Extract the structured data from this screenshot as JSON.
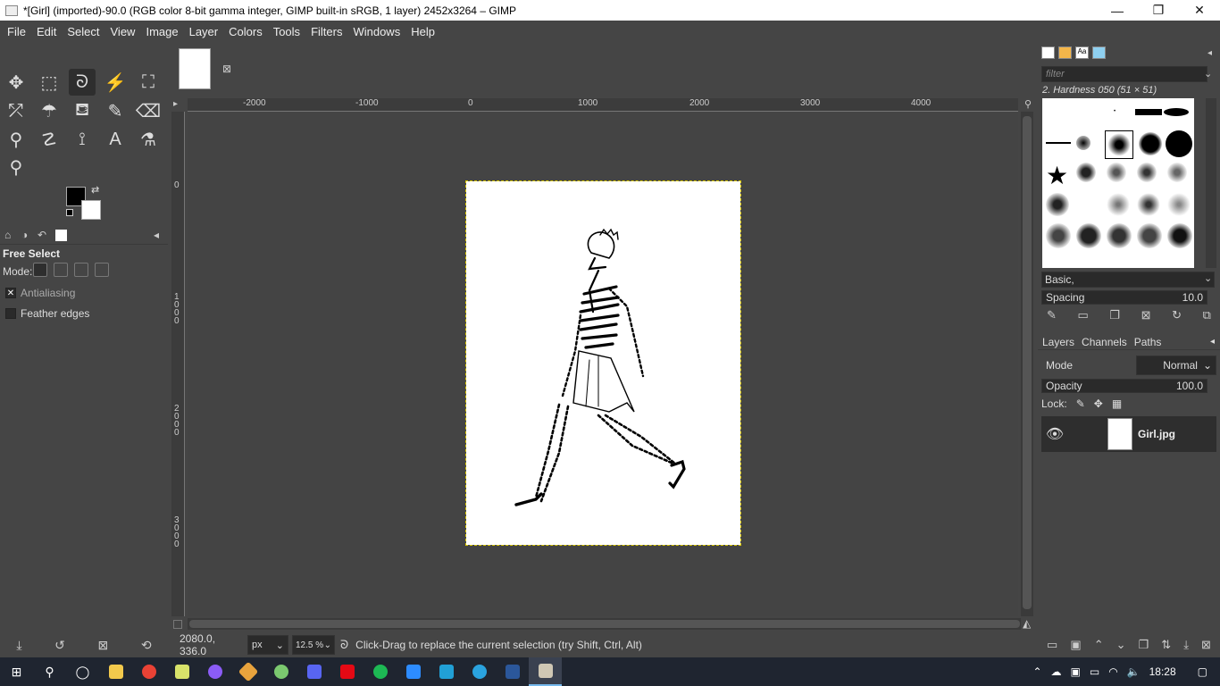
{
  "window": {
    "title": "*[Girl] (imported)-90.0 (RGB color 8-bit gamma integer, GIMP built-in sRGB, 1 layer) 2452x3264 – GIMP",
    "minimize": "—",
    "restore": "❐",
    "close": "✕"
  },
  "menubar": [
    "File",
    "Edit",
    "Select",
    "View",
    "Image",
    "Layer",
    "Colors",
    "Tools",
    "Filters",
    "Windows",
    "Help"
  ],
  "toolbox": {
    "tools": [
      {
        "name": "move-tool-icon",
        "glyph": "✥"
      },
      {
        "name": "rect-select-tool-icon",
        "glyph": "⬚"
      },
      {
        "name": "free-select-tool-icon",
        "glyph": "ᘐ"
      },
      {
        "name": "fuzzy-select-tool-icon",
        "glyph": "⚡"
      },
      {
        "name": "crop-tool-icon",
        "glyph": "⛶"
      },
      {
        "name": "unified-transform-tool-icon",
        "glyph": "⤱"
      },
      {
        "name": "warp-transform-tool-icon",
        "glyph": "☂"
      },
      {
        "name": "bucket-fill-tool-icon",
        "glyph": "⛾"
      },
      {
        "name": "paintbrush-tool-icon",
        "glyph": "✎"
      },
      {
        "name": "eraser-tool-icon",
        "glyph": "⌫"
      },
      {
        "name": "clone-tool-icon",
        "glyph": "⚲"
      },
      {
        "name": "smudge-tool-icon",
        "glyph": "☡"
      },
      {
        "name": "paths-tool-icon",
        "glyph": "⟟"
      },
      {
        "name": "text-tool-icon",
        "glyph": "A"
      },
      {
        "name": "color-picker-tool-icon",
        "glyph": "⚗"
      },
      {
        "name": "zoom-tool-icon",
        "glyph": "⚲"
      }
    ],
    "active_tool": "free-select-tool-icon"
  },
  "tool_options": {
    "title": "Free Select",
    "mode_label": "Mode:",
    "antialiasing_label": "Antialiasing",
    "antialiasing_checked": true,
    "feather_label": "Feather edges",
    "feather_checked": false
  },
  "canvas": {
    "ruler_top_labels": [
      "-2000",
      "-1000",
      "0",
      "1000",
      "2000",
      "3000",
      "4000"
    ],
    "ruler_left_labels": [
      "0",
      "1\n0\n0\n0",
      "2\n0\n0\n0",
      "3\n0\n0\n0"
    ],
    "image_name": "Girl"
  },
  "statusbar": {
    "coords": "2080.0, 336.0",
    "unit": "px",
    "zoom": "12.5 %",
    "message": "Click-Drag to replace the current selection (try Shift, Ctrl, Alt)"
  },
  "brushes": {
    "filter_placeholder": "filter",
    "selected_brush": "2. Hardness 050 (51 × 51)",
    "preset": "Basic,",
    "spacing_label": "Spacing",
    "spacing_value": "10.0"
  },
  "layers": {
    "tabs": [
      "Layers",
      "Channels",
      "Paths"
    ],
    "mode_label": "Mode",
    "mode_value": "Normal",
    "opacity_label": "Opacity",
    "opacity_value": "100.0",
    "lock_label": "Lock:",
    "layer_name": "Girl.jpg"
  },
  "taskbar": {
    "time": "18:28",
    "apps": [
      "start",
      "search",
      "cortana",
      "file-explorer",
      "chrome",
      "notepad",
      "app-purple",
      "app-git",
      "app-color",
      "discord",
      "netflix",
      "spotify",
      "zoom",
      "app-g",
      "telegram",
      "word",
      "gimp"
    ]
  },
  "colors": {
    "accent": "#76b9ed",
    "fg": "#000000",
    "bg": "#ffffff"
  }
}
